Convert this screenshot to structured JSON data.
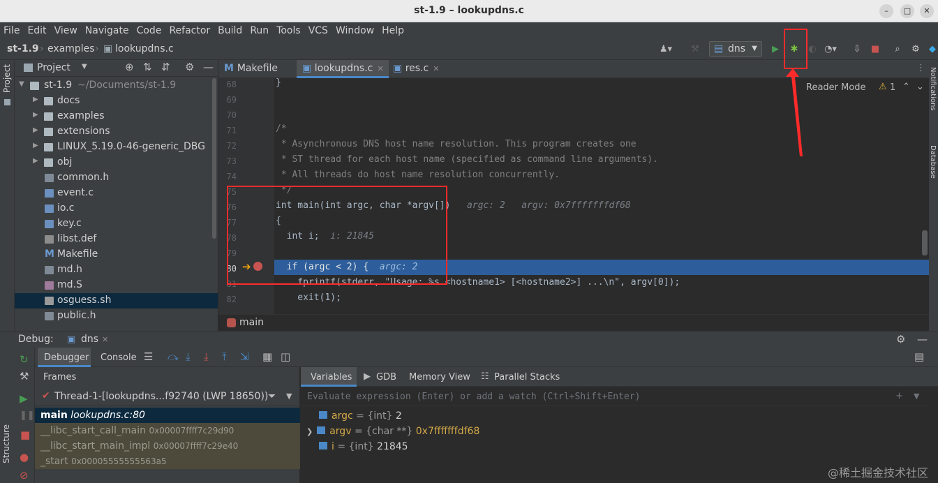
{
  "window": {
    "title": "st-1.9 – lookupdns.c"
  },
  "menu": [
    "File",
    "Edit",
    "View",
    "Navigate",
    "Code",
    "Refactor",
    "Build",
    "Run",
    "Tools",
    "VCS",
    "Window",
    "Help"
  ],
  "breadcrumb": {
    "project": "st-1.9",
    "folder": "examples",
    "file": "lookupdns.c"
  },
  "run_config": "dns",
  "project_panel": {
    "title": "Project",
    "root": {
      "name": "st-1.9",
      "path": "~/Documents/st-1.9"
    },
    "items": [
      {
        "name": "docs",
        "type": "folder"
      },
      {
        "name": "examples",
        "type": "folder"
      },
      {
        "name": "extensions",
        "type": "folder"
      },
      {
        "name": "LINUX_5.19.0-46-generic_DBG",
        "type": "folder"
      },
      {
        "name": "obj",
        "type": "folder"
      },
      {
        "name": "common.h",
        "type": "h"
      },
      {
        "name": "event.c",
        "type": "c"
      },
      {
        "name": "io.c",
        "type": "c"
      },
      {
        "name": "key.c",
        "type": "c"
      },
      {
        "name": "libst.def",
        "type": "def"
      },
      {
        "name": "Makefile",
        "type": "make"
      },
      {
        "name": "md.h",
        "type": "h"
      },
      {
        "name": "md.S",
        "type": "s"
      },
      {
        "name": "osguess.sh",
        "type": "sh"
      },
      {
        "name": "public.h",
        "type": "h"
      }
    ]
  },
  "side_labels": {
    "left_top": "Project",
    "left_bottom": "Structure",
    "right_top": "Notifications",
    "right_mid": "Database"
  },
  "editor": {
    "tabs": [
      {
        "label": "Makefile",
        "active": false
      },
      {
        "label": "lookupdns.c",
        "active": true
      },
      {
        "label": "res.c",
        "active": false
      }
    ],
    "reader_mode": "Reader Mode",
    "warnings": "1",
    "lines": [
      {
        "n": "68",
        "code": "}"
      },
      {
        "n": "69",
        "code": ""
      },
      {
        "n": "70",
        "code": ""
      },
      {
        "n": "71",
        "code": "/*"
      },
      {
        "n": "72",
        "code": " * Asynchronous DNS host name resolution. This program creates one"
      },
      {
        "n": "73",
        "code": " * ST thread for each host name (specified as command line arguments)."
      },
      {
        "n": "74",
        "code": " * All threads do host name resolution concurrently."
      },
      {
        "n": "75",
        "code": " */"
      },
      {
        "n": "76",
        "code": "int main(int argc, char *argv[])"
      },
      {
        "n": "77",
        "code": "{"
      },
      {
        "n": "78",
        "code": "  int i;"
      },
      {
        "n": "79",
        "code": ""
      },
      {
        "n": "80",
        "code": "  if (argc < 2) {"
      },
      {
        "n": "81",
        "code": "    fprintf(stderr, \"Usage: %s <hostname1> [<hostname2>] ...\\n\", argv[0]);"
      },
      {
        "n": "82",
        "code": "    exit(1);"
      }
    ],
    "hints": {
      "l76_argc": "argc: 2",
      "l76_argv": "argv: 0x7fffffffdf68",
      "l78": "i: 21845",
      "l80": "argc: 2"
    },
    "function_breadcrumb": "main"
  },
  "debug": {
    "label": "Debug:",
    "session": "dns",
    "tabs": [
      "Debugger",
      "Console"
    ],
    "frames_title": "Frames",
    "thread": "Thread-1-[lookupdns...f92740 (LWP 18650))",
    "frames": [
      {
        "fn": "main",
        "loc": "lookupdns.c:80",
        "selected": true
      },
      {
        "fn": "__libc_start_call_main",
        "loc": "0x00007ffff7c29d90",
        "selected": false
      },
      {
        "fn": "__libc_start_main_impl",
        "loc": "0x00007ffff7c29e40",
        "selected": false
      },
      {
        "fn": "_start",
        "loc": "0x00005555555563a5",
        "selected": false
      }
    ],
    "var_tabs": [
      "Variables",
      "GDB",
      "Memory View",
      "Parallel Stacks"
    ],
    "eval_placeholder": "Evaluate expression (Enter) or add a watch (Ctrl+Shift+Enter)",
    "variables": [
      {
        "name": "argc",
        "type": "= {int}",
        "value": "2"
      },
      {
        "name": "argv",
        "type": "= {char **}",
        "value": "0x7fffffffdf68"
      },
      {
        "name": "i",
        "type": "= {int}",
        "value": "21845"
      }
    ]
  },
  "watermark": "@稀土掘金技术社区",
  "colors": {
    "accent": "#4a88c7",
    "annotation": "#ff2b2b",
    "keyword": "#cc7832",
    "string": "#6a8759"
  }
}
